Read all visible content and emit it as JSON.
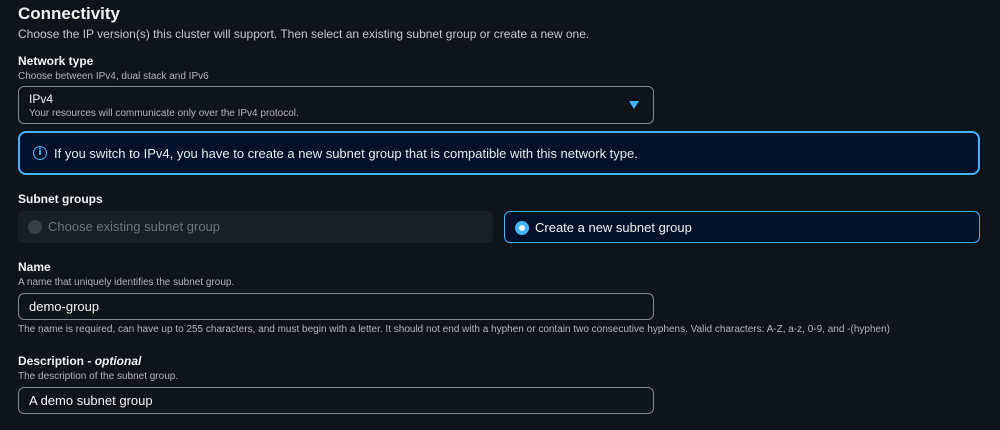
{
  "section": {
    "title": "Connectivity",
    "description": "Choose the IP version(s) this cluster will support. Then select an existing subnet group or create a new one."
  },
  "network_type": {
    "label": "Network type",
    "hint": "Choose between IPv4, dual stack and IPv6",
    "selected_value": "IPv4",
    "selected_description": "Your resources will communicate only over the IPv4 protocol."
  },
  "info_alert": {
    "text": "If you switch to IPv4, you have to create a new subnet group that is compatible with this network type.",
    "icon": "info-icon"
  },
  "subnet_groups": {
    "label": "Subnet groups",
    "options": [
      {
        "label": "Choose existing subnet group",
        "state": "disabled"
      },
      {
        "label": "Create a new subnet group",
        "state": "selected"
      }
    ]
  },
  "name": {
    "label": "Name",
    "hint": "A name that uniquely identifies the subnet group.",
    "value": "demo-group",
    "constraint": "The name is required, can have up to 255 characters, and must begin with a letter. It should not end with a hyphen or contain two consecutive hyphens. Valid characters: A-Z, a-z, 0-9, and -(hyphen)"
  },
  "description": {
    "label": "Description",
    "optional_tag": "optional",
    "hint": "The description of the subnet group.",
    "value": "A demo subnet group"
  },
  "colors": {
    "background": "#0f141a",
    "accent": "#42b4ff",
    "text_primary": "#f2f3f3",
    "text_secondary": "#b0b4bb",
    "border": "#7d8998"
  }
}
